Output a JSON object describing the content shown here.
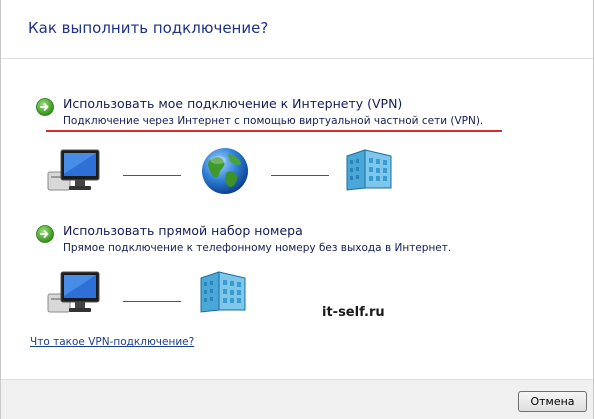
{
  "header": {
    "title": "Как выполнить подключение?"
  },
  "options": [
    {
      "title": "Использовать мое подключение к Интернету (VPN)",
      "description": "Подключение через Интернет с помощью виртуальной частной сети (VPN).",
      "icon": "green-arrow-icon"
    },
    {
      "title": "Использовать прямой набор номера",
      "description": "Прямое подключение к телефонному номеру без выхода в Интернет.",
      "icon": "green-arrow-icon"
    }
  ],
  "diagrams": {
    "vpn": [
      "computer-icon",
      "globe-icon",
      "server-building-icon"
    ],
    "dial": [
      "computer-icon",
      "server-building-icon"
    ]
  },
  "watermark": "it-self.ru",
  "help_link": "Что такое VPN-подключение?",
  "footer": {
    "cancel_label": "Отмена"
  },
  "colors": {
    "title_blue": "#1e3287",
    "arrow_green": "#3ca21e",
    "underline_red": "#d42b2b",
    "footer_bg": "#f0f0f0"
  }
}
